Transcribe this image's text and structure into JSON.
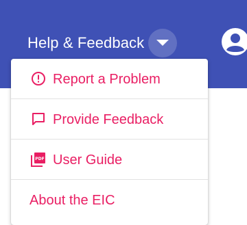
{
  "header": {
    "help_label": "Help & Feedback",
    "caret_icon": "chevron-down-icon",
    "avatar_icon": "account-circle-icon"
  },
  "colors": {
    "topbar": "#3f51b5",
    "accent": "#e91e63",
    "menu_bg": "#ffffff"
  },
  "menu": {
    "items": [
      {
        "label": "Report a Problem",
        "icon": "alert-circle-icon"
      },
      {
        "label": "Provide Feedback",
        "icon": "comment-icon"
      },
      {
        "label": "User Guide",
        "icon": "pdf-icon",
        "icon_text": "PDF"
      },
      {
        "label": "About the EIC"
      }
    ]
  }
}
